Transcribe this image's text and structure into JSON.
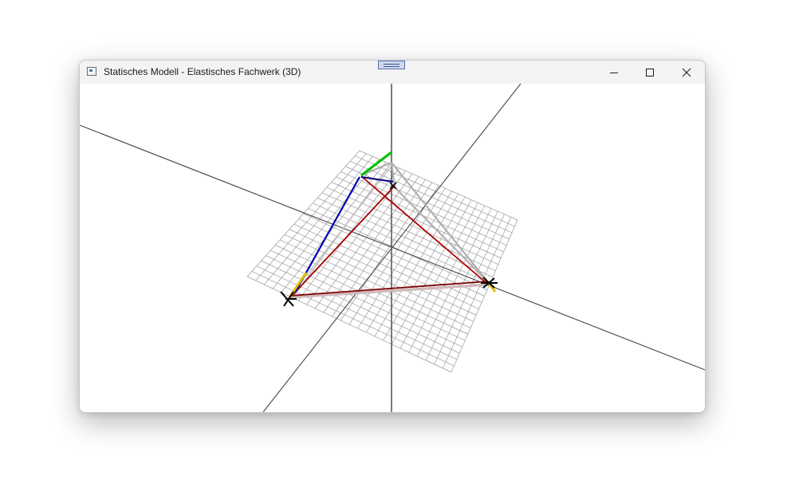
{
  "window": {
    "title": "Statisches Modell - Elastisches Fachwerk (3D)",
    "icon": "app-window-icon",
    "controls": {
      "minimize": "minimize-icon",
      "maximize": "maximize-icon",
      "close": "close-icon"
    }
  },
  "colors": {
    "axis": "#505050",
    "grid": "#9a9a9a",
    "member_red": "#b00000",
    "member_dark_red": "#7a0000",
    "member_blue": "#0000b0",
    "member_grey": "#b0b0b0",
    "axis_green": "#00c000",
    "axis_yellow": "#e0c000",
    "support": "#000000"
  },
  "scene": {
    "support_icons": [
      "support-node-icon",
      "support-node-icon"
    ],
    "model_parts": [
      "ground-grid",
      "truss-members",
      "coordinate-axes"
    ]
  }
}
